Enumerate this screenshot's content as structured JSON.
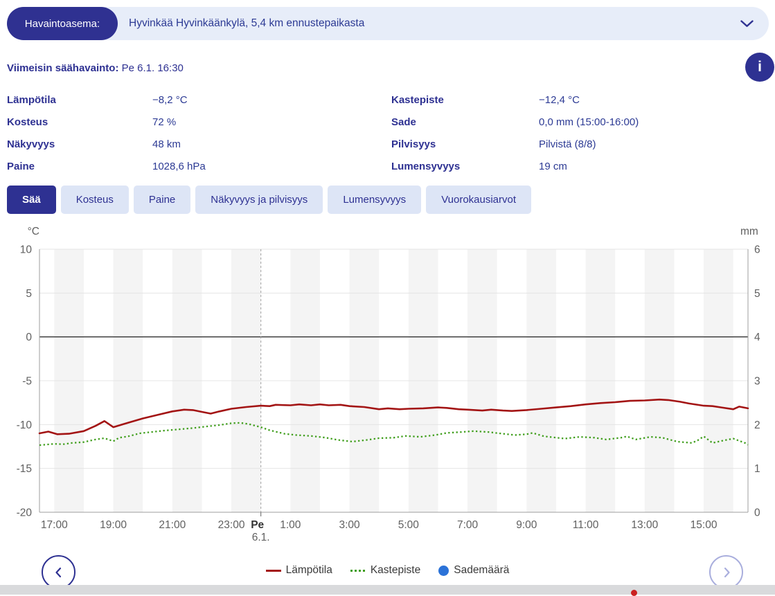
{
  "station_bar": {
    "label": "Havaintoasema:",
    "value": "Hyvinkää Hyvinkäänkylä, 5,4 km ennustepaikasta"
  },
  "latest": {
    "label": "Viimeisin säähavainto:",
    "value": "Pe 6.1. 16:30"
  },
  "observations": {
    "left": [
      {
        "label": "Lämpötila",
        "value": "−8,2 °C"
      },
      {
        "label": "Kosteus",
        "value": "72 %"
      },
      {
        "label": "Näkyvyys",
        "value": "48 km"
      },
      {
        "label": "Paine",
        "value": "1028,6 hPa"
      }
    ],
    "right": [
      {
        "label": "Kastepiste",
        "value": "−12,4 °C"
      },
      {
        "label": "Sade",
        "value": "0,0 mm (15:00-16:00)"
      },
      {
        "label": "Pilvisyys",
        "value": "Pilvistä (8/8)"
      },
      {
        "label": "Lumensyvyys",
        "value": "19 cm"
      }
    ]
  },
  "tabs": [
    {
      "label": "Sää",
      "active": true
    },
    {
      "label": "Kosteus",
      "active": false
    },
    {
      "label": "Paine",
      "active": false
    },
    {
      "label": "Näkyvyys ja pilvisyys",
      "active": false
    },
    {
      "label": "Lumensyvyys",
      "active": false
    },
    {
      "label": "Vuorokausiarvot",
      "active": false
    }
  ],
  "colors": {
    "brand": "#2e3192",
    "bar_bg": "#e7edf9",
    "tab_bg": "#dde5f6",
    "temperature": "#a31414",
    "dewpoint": "#3f9e1c",
    "rain": "#2b72d8",
    "grid": "#e4e4e4",
    "zero_line": "#3c3c3c",
    "axis": "#9e9e9e",
    "tick_text": "#606060",
    "band": "#f4f4f4",
    "midnight": "#a0a0a0"
  },
  "chart_data": {
    "type": "line",
    "title": "",
    "axis_left_unit": "°C",
    "axis_right_unit": "mm",
    "x_range_hours": [
      16.5,
      40.5
    ],
    "y_left": {
      "min": -20,
      "max": 10,
      "ticks": [
        10,
        5,
        0,
        -5,
        -10,
        -15,
        -20
      ]
    },
    "y_right": {
      "min": 0,
      "max": 6,
      "ticks": [
        6,
        5,
        4,
        3,
        2,
        1,
        0
      ]
    },
    "x_ticks": [
      {
        "t": 17,
        "label": "17:00"
      },
      {
        "t": 19,
        "label": "19:00"
      },
      {
        "t": 21,
        "label": "21:00"
      },
      {
        "t": 23,
        "label": "23:00"
      },
      {
        "t": 24,
        "label": "Pe",
        "sublabel": "6.1.",
        "bold": true
      },
      {
        "t": 25,
        "label": "1:00"
      },
      {
        "t": 27,
        "label": "3:00"
      },
      {
        "t": 29,
        "label": "5:00"
      },
      {
        "t": 31,
        "label": "7:00"
      },
      {
        "t": 33,
        "label": "9:00"
      },
      {
        "t": 35,
        "label": "11:00"
      },
      {
        "t": 37,
        "label": "13:00"
      },
      {
        "t": 39,
        "label": "15:00"
      }
    ],
    "midnight_line_t": 24,
    "band_start_hours": [
      17,
      19,
      21,
      23,
      25,
      27,
      29,
      31,
      33,
      35,
      37,
      39
    ],
    "series": [
      {
        "name": "Lämpötila",
        "style": "solid",
        "color": "#a31414",
        "unit": "°C",
        "points": [
          [
            16.5,
            -11.0
          ],
          [
            16.8,
            -10.8
          ],
          [
            17.1,
            -11.1
          ],
          [
            17.5,
            -11.05
          ],
          [
            18.0,
            -10.75
          ],
          [
            18.4,
            -10.15
          ],
          [
            18.7,
            -9.6
          ],
          [
            19.0,
            -10.3
          ],
          [
            19.3,
            -10.0
          ],
          [
            19.6,
            -9.7
          ],
          [
            20.0,
            -9.3
          ],
          [
            20.5,
            -8.9
          ],
          [
            21.0,
            -8.5
          ],
          [
            21.4,
            -8.3
          ],
          [
            21.7,
            -8.35
          ],
          [
            22.0,
            -8.55
          ],
          [
            22.3,
            -8.75
          ],
          [
            22.6,
            -8.5
          ],
          [
            23.0,
            -8.2
          ],
          [
            23.5,
            -8.0
          ],
          [
            24.0,
            -7.85
          ],
          [
            24.3,
            -7.9
          ],
          [
            24.5,
            -7.75
          ],
          [
            25.0,
            -7.8
          ],
          [
            25.3,
            -7.7
          ],
          [
            25.7,
            -7.8
          ],
          [
            26.0,
            -7.7
          ],
          [
            26.3,
            -7.8
          ],
          [
            26.7,
            -7.75
          ],
          [
            27.0,
            -7.9
          ],
          [
            27.5,
            -8.0
          ],
          [
            28.0,
            -8.25
          ],
          [
            28.3,
            -8.15
          ],
          [
            28.7,
            -8.25
          ],
          [
            29.0,
            -8.2
          ],
          [
            29.5,
            -8.15
          ],
          [
            30.0,
            -8.05
          ],
          [
            30.3,
            -8.1
          ],
          [
            30.7,
            -8.25
          ],
          [
            31.0,
            -8.3
          ],
          [
            31.5,
            -8.4
          ],
          [
            31.8,
            -8.3
          ],
          [
            32.2,
            -8.4
          ],
          [
            32.5,
            -8.45
          ],
          [
            33.0,
            -8.35
          ],
          [
            33.5,
            -8.2
          ],
          [
            34.0,
            -8.05
          ],
          [
            34.5,
            -7.9
          ],
          [
            35.0,
            -7.7
          ],
          [
            35.5,
            -7.55
          ],
          [
            36.0,
            -7.45
          ],
          [
            36.5,
            -7.3
          ],
          [
            37.0,
            -7.25
          ],
          [
            37.5,
            -7.15
          ],
          [
            37.8,
            -7.2
          ],
          [
            38.2,
            -7.4
          ],
          [
            38.5,
            -7.6
          ],
          [
            39.0,
            -7.85
          ],
          [
            39.3,
            -7.9
          ],
          [
            39.6,
            -8.05
          ],
          [
            40.0,
            -8.25
          ],
          [
            40.2,
            -7.95
          ],
          [
            40.35,
            -8.05
          ],
          [
            40.5,
            -8.15
          ]
        ]
      },
      {
        "name": "Kastepiste",
        "style": "dotted",
        "color": "#3f9e1c",
        "unit": "°C",
        "points": [
          [
            16.5,
            -12.35
          ],
          [
            17.0,
            -12.2
          ],
          [
            17.3,
            -12.25
          ],
          [
            17.6,
            -12.1
          ],
          [
            18.0,
            -12.0
          ],
          [
            18.4,
            -11.7
          ],
          [
            18.7,
            -11.55
          ],
          [
            19.0,
            -11.9
          ],
          [
            19.2,
            -11.5
          ],
          [
            19.5,
            -11.35
          ],
          [
            19.9,
            -11.0
          ],
          [
            20.3,
            -10.85
          ],
          [
            20.7,
            -10.7
          ],
          [
            21.2,
            -10.55
          ],
          [
            21.7,
            -10.4
          ],
          [
            22.2,
            -10.2
          ],
          [
            22.6,
            -10.05
          ],
          [
            23.0,
            -9.85
          ],
          [
            23.3,
            -9.8
          ],
          [
            23.6,
            -9.95
          ],
          [
            24.0,
            -10.3
          ],
          [
            24.3,
            -10.65
          ],
          [
            24.8,
            -11.05
          ],
          [
            25.2,
            -11.2
          ],
          [
            25.7,
            -11.3
          ],
          [
            26.2,
            -11.5
          ],
          [
            26.6,
            -11.75
          ],
          [
            27.1,
            -11.95
          ],
          [
            27.6,
            -11.75
          ],
          [
            28.0,
            -11.55
          ],
          [
            28.5,
            -11.5
          ],
          [
            28.9,
            -11.3
          ],
          [
            29.4,
            -11.4
          ],
          [
            29.9,
            -11.2
          ],
          [
            30.3,
            -10.95
          ],
          [
            30.8,
            -10.85
          ],
          [
            31.2,
            -10.75
          ],
          [
            31.7,
            -10.85
          ],
          [
            32.2,
            -11.05
          ],
          [
            32.6,
            -11.2
          ],
          [
            33.0,
            -11.1
          ],
          [
            33.2,
            -10.95
          ],
          [
            33.6,
            -11.35
          ],
          [
            34.3,
            -11.6
          ],
          [
            34.8,
            -11.4
          ],
          [
            35.3,
            -11.5
          ],
          [
            35.7,
            -11.7
          ],
          [
            36.2,
            -11.5
          ],
          [
            36.4,
            -11.35
          ],
          [
            36.7,
            -11.7
          ],
          [
            37.2,
            -11.4
          ],
          [
            37.6,
            -11.5
          ],
          [
            38.1,
            -11.95
          ],
          [
            38.6,
            -12.1
          ],
          [
            38.8,
            -11.8
          ],
          [
            39.0,
            -11.35
          ],
          [
            39.3,
            -12.1
          ],
          [
            39.7,
            -11.8
          ],
          [
            40.0,
            -11.6
          ],
          [
            40.4,
            -12.1
          ],
          [
            40.5,
            -12.3
          ]
        ]
      },
      {
        "name": "Sademäärä",
        "style": "bar",
        "color": "#2b72d8",
        "unit": "mm",
        "points": []
      }
    ],
    "legend": [
      "Lämpötila",
      "Kastepiste",
      "Sademäärä"
    ],
    "legend_position": "bottom"
  }
}
